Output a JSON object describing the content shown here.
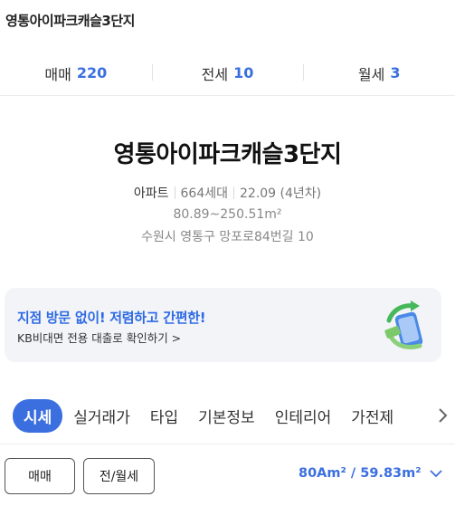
{
  "header": {
    "title": "영통아이파크캐슬3단지"
  },
  "trade_tabs": [
    {
      "label": "매매",
      "count": "220"
    },
    {
      "label": "전세",
      "count": "10"
    },
    {
      "label": "월세",
      "count": "3"
    }
  ],
  "complex": {
    "name": "영통아이파크캐슬3단지",
    "type": "아파트",
    "households": "664세대",
    "built": "22.09 (4년차)",
    "area_range": "80.89~250.51m²",
    "address": "수원시 영통구 망포로84번길 10"
  },
  "banner": {
    "headline": "지점 방문 없이! 저렴하고 간편한!",
    "sub": "KB비대면 전용 대출로 확인하기 >"
  },
  "section_tabs": [
    {
      "label": "시세",
      "active": true
    },
    {
      "label": "실거래가",
      "active": false
    },
    {
      "label": "타입",
      "active": false
    },
    {
      "label": "기본정보",
      "active": false
    },
    {
      "label": "인테리어",
      "active": false
    },
    {
      "label": "가전제",
      "active": false
    }
  ],
  "filters": {
    "sale_label": "매매",
    "lease_label": "전/월세",
    "area_label": "80Am² / 59.83m²"
  },
  "colors": {
    "accent": "#3b6fe0",
    "banner_bg": "#f2f4f8"
  },
  "icons": [
    "phone-money-icon",
    "chevron-right-icon",
    "chevron-down-icon"
  ]
}
